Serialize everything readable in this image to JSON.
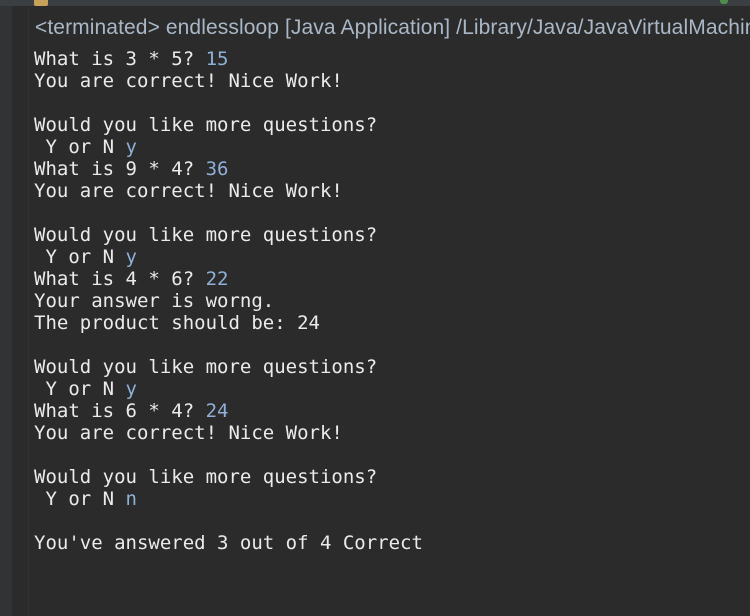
{
  "console": {
    "status": "<terminated> endlessloop [Java Application] /Library/Java/JavaVirtualMachines/jdk/Contents/Home/bin/java",
    "lines": [
      {
        "text": "What is 3 * 5? ",
        "input": "15"
      },
      {
        "text": "You are correct! Nice Work!",
        "input": ""
      },
      {
        "text": "",
        "input": ""
      },
      {
        "text": "Would you like more questions?",
        "input": ""
      },
      {
        "text": " Y or N ",
        "input": "y"
      },
      {
        "text": "What is 9 * 4? ",
        "input": "36"
      },
      {
        "text": "You are correct! Nice Work!",
        "input": ""
      },
      {
        "text": "",
        "input": ""
      },
      {
        "text": "Would you like more questions?",
        "input": ""
      },
      {
        "text": " Y or N ",
        "input": "y"
      },
      {
        "text": "What is 4 * 6? ",
        "input": "22"
      },
      {
        "text": "Your answer is worng.",
        "input": ""
      },
      {
        "text": "The product should be: 24",
        "input": ""
      },
      {
        "text": "",
        "input": ""
      },
      {
        "text": "Would you like more questions?",
        "input": ""
      },
      {
        "text": " Y or N ",
        "input": "y"
      },
      {
        "text": "What is 6 * 4? ",
        "input": "24"
      },
      {
        "text": "You are correct! Nice Work!",
        "input": ""
      },
      {
        "text": "",
        "input": ""
      },
      {
        "text": "Would you like more questions?",
        "input": ""
      },
      {
        "text": " Y or N ",
        "input": "n"
      },
      {
        "text": "",
        "input": ""
      },
      {
        "text": "You've answered 3 out of 4 Correct",
        "input": ""
      }
    ]
  }
}
